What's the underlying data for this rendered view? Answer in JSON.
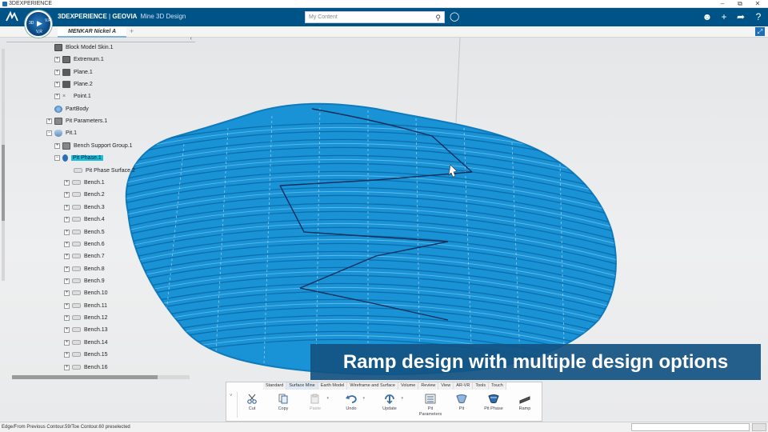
{
  "window": {
    "title": "3DEXPERIENCE",
    "minimize": "–",
    "restore": "⧉",
    "close": "✕"
  },
  "topbar": {
    "brand_prefix": "3DEXPERIENCE",
    "brand_company": "GEOVIA",
    "app_name": "Mine 3D Design",
    "search_placeholder": "My Content",
    "accent": "#005386"
  },
  "compass": {
    "left_label": "3D",
    "right_label": "V.R",
    "bottom_label": "V,R"
  },
  "tabs": {
    "document": "MENKAR Nickel A",
    "add": "+"
  },
  "tree": {
    "items": [
      {
        "label": "Block Model Skin.1"
      },
      {
        "label": "Extremum.1"
      },
      {
        "label": "Plane.1"
      },
      {
        "label": "Plane.2"
      },
      {
        "label": "Point.1"
      },
      {
        "label": "PartBody"
      },
      {
        "label": "Pit Parameters.1"
      },
      {
        "label": "Pit.1"
      },
      {
        "label": "Bench Support Group.1"
      },
      {
        "label": "Pit Phase.1"
      },
      {
        "label": "Pit Phase Surface.2"
      },
      {
        "label": "Bench.1"
      },
      {
        "label": "Bench.2"
      },
      {
        "label": "Bench.3"
      },
      {
        "label": "Bench.4"
      },
      {
        "label": "Bench.5"
      },
      {
        "label": "Bench.6"
      },
      {
        "label": "Bench.7"
      },
      {
        "label": "Bench.8"
      },
      {
        "label": "Bench.9"
      },
      {
        "label": "Bench.10"
      },
      {
        "label": "Bench.11"
      },
      {
        "label": "Bench.12"
      },
      {
        "label": "Bench.13"
      },
      {
        "label": "Bench.14"
      },
      {
        "label": "Bench.15"
      },
      {
        "label": "Bench.16"
      }
    ]
  },
  "caption": "Ramp design with multiple design options",
  "action_bar": {
    "tabs": [
      "Standard",
      "Surface Mine",
      "Earth Model",
      "Wireframe and Surface",
      "Volume",
      "Review",
      "View",
      "AR-VR",
      "Tools",
      "Touch"
    ],
    "active_tab": "Surface Mine",
    "commands": {
      "cut": "Cut",
      "copy": "Copy",
      "paste": "Paste",
      "undo": "Undo",
      "update": "Update",
      "pit_parameters": "Pit Parameters",
      "pit": "Pit",
      "pit_phase": "Pit Phase",
      "ramp": "Ramp"
    }
  },
  "status": {
    "message": "Edge/From Previous Contour.59/Toe Contour.60 preselected"
  },
  "colors": {
    "pit_surface": "#1a93d6",
    "selection": "#18c0d8",
    "caption_bg": "#125282"
  }
}
